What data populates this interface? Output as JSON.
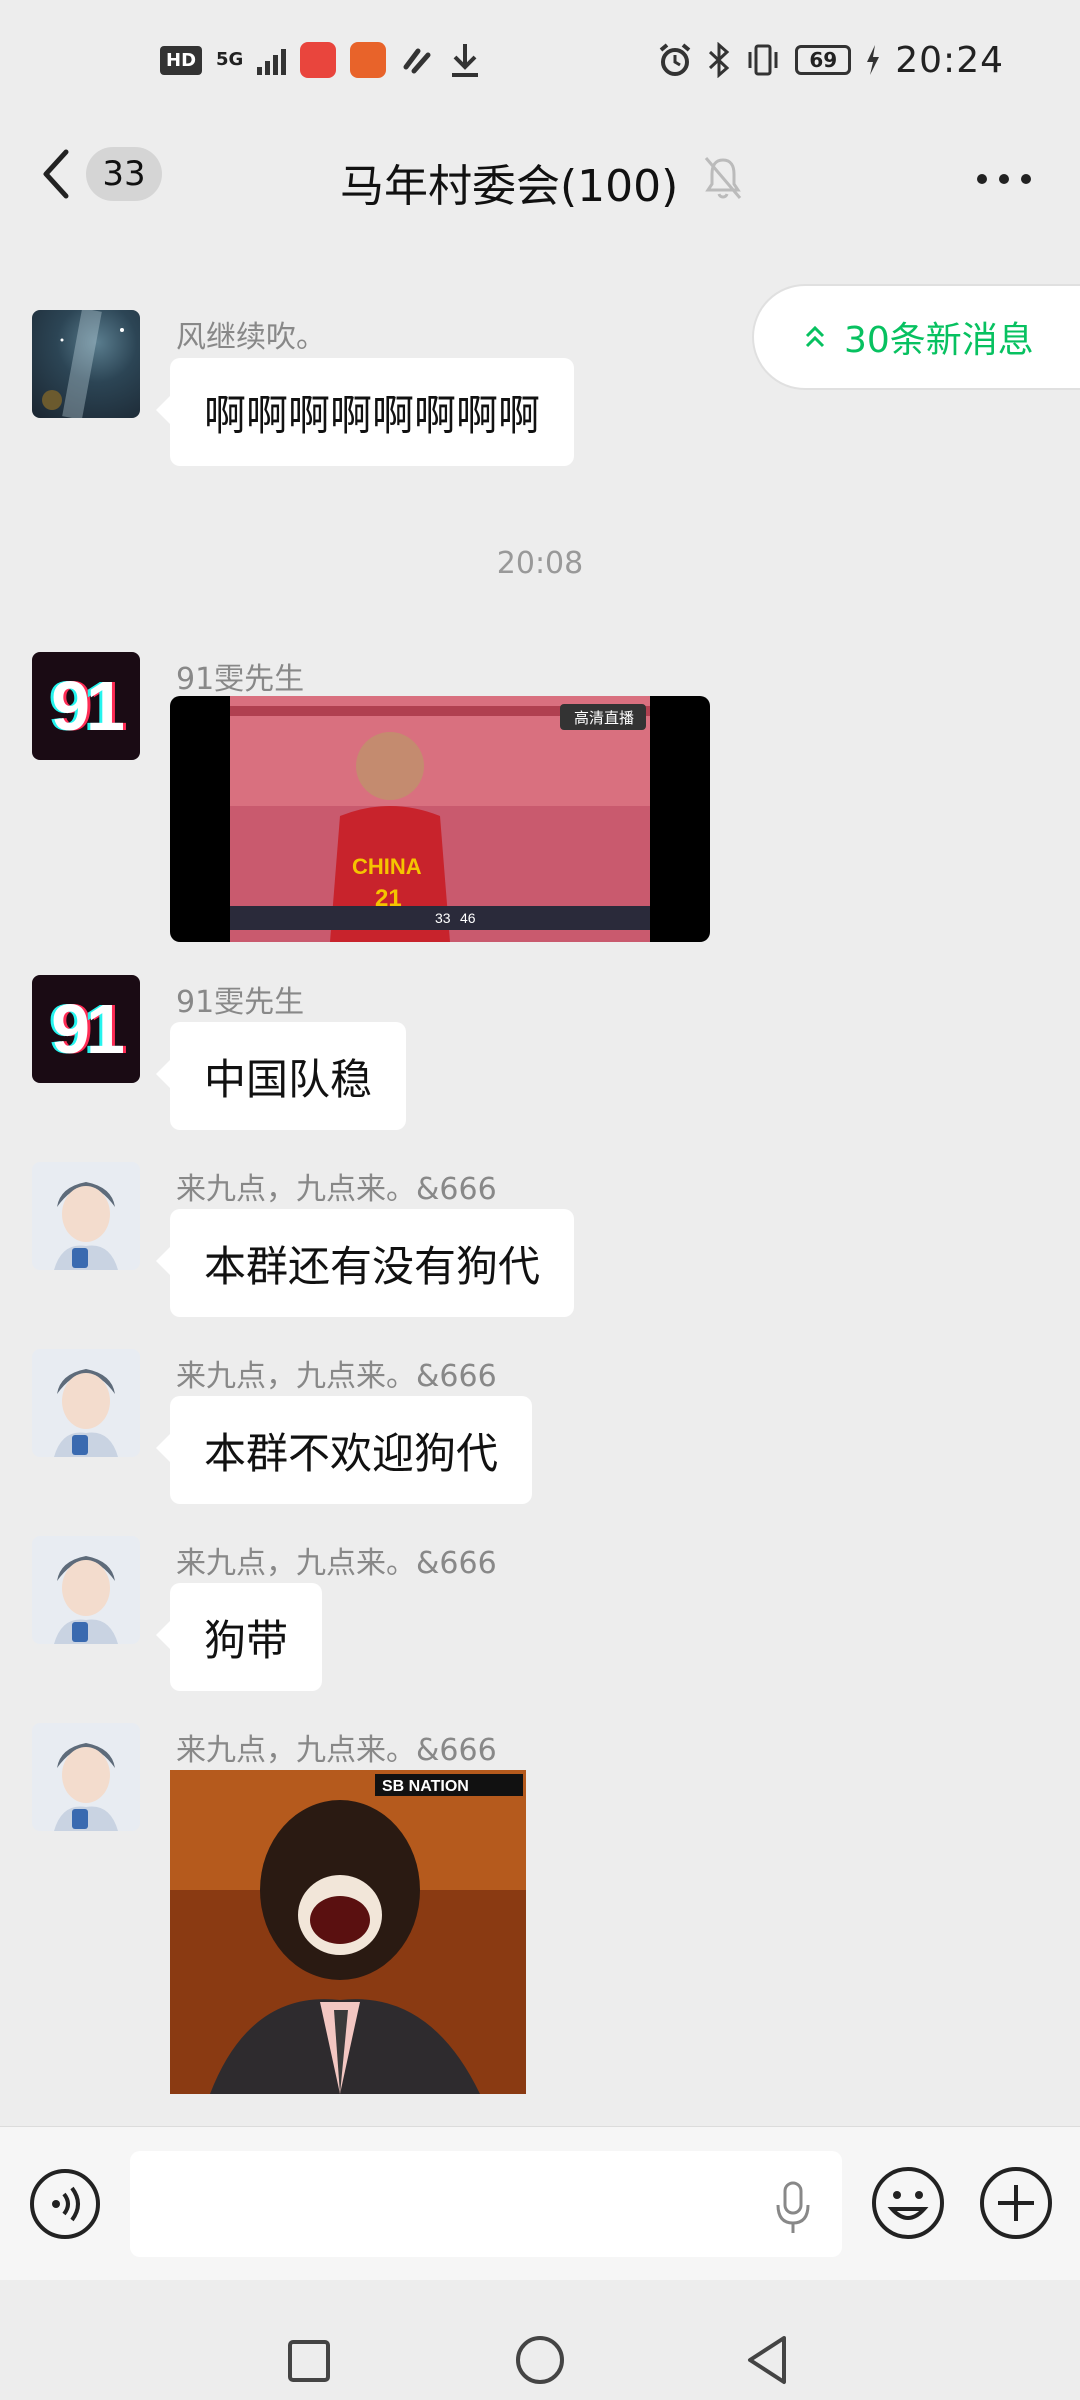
{
  "status_bar": {
    "hd": "HD",
    "network": "5G",
    "time": "20:24",
    "battery": "69"
  },
  "header": {
    "unread_count": "33",
    "title": "马年村委会(100)"
  },
  "new_messages_pill": {
    "label": "30条新消息"
  },
  "timestamp": "20:08",
  "messages": [
    {
      "sender": "风继续吹。",
      "text": "啊啊啊啊啊啊啊啊"
    },
    {
      "sender": "91雯先生",
      "type": "image"
    },
    {
      "sender": "91雯先生",
      "text": "中国队稳"
    },
    {
      "sender": "来九点，九点来。&666",
      "text": "本群还有没有狗代"
    },
    {
      "sender": "来九点，九点来。&666",
      "text": "本群不欢迎狗代"
    },
    {
      "sender": "来九点，九点来。&666",
      "text": "狗带"
    },
    {
      "sender": "来九点，九点来。&666",
      "type": "image"
    }
  ],
  "avatars": {
    "91_label": "91"
  },
  "video_overlay": {
    "jersey": "CHINA",
    "number": "21",
    "channel": "高清直播",
    "score_left": "33",
    "score_right": "46"
  },
  "meme_overlay": {
    "watermark": "SB NATION"
  },
  "input": {
    "placeholder": ""
  },
  "colors": {
    "accent": "#07c160",
    "background": "#ededed",
    "bubble": "#ffffff"
  }
}
